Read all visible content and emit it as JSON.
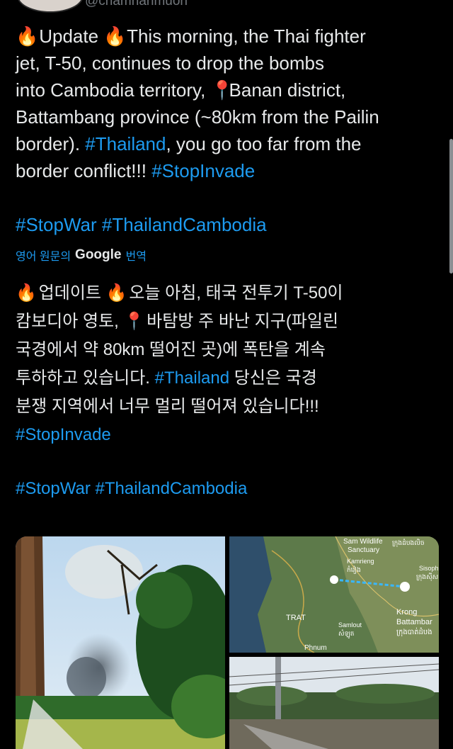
{
  "header": {
    "handle": "@chamnanmuon"
  },
  "post": {
    "lines": [
      {
        "emoji_a": "🔥",
        "t1": "Update",
        "emoji_b": "🔥",
        "t2": "This morning, the Thai fighter"
      },
      {
        "t": "jet, T-50, continues to drop the bombs"
      },
      {
        "t1": "into Cambodia territory,",
        "pin": "📍",
        "t2": "Banan district,"
      },
      {
        "t": "Battambang province (~80km from the Pailin"
      },
      {
        "t1": "border).",
        "tag": "#Thailand",
        "t2": ", you go too far from the"
      },
      {
        "t1": "border conflict!!!",
        "tag": "#StopInvade"
      }
    ],
    "tags_line": [
      "#StopWar",
      "#ThailandCambodia"
    ]
  },
  "translation": {
    "prefix": "영어 원문의",
    "google": "Google",
    "suffix": "번역",
    "lines": [
      {
        "emoji_a": "🔥",
        "t1": "업데이트",
        "emoji_b": "🔥",
        "t2": "오늘 아침, 태국 전투기 T-50이"
      },
      {
        "t1": "캄보디아 영토,",
        "pin": "📍",
        "t2": "바탐방 주 바난 지구(파일린"
      },
      {
        "t": "국경에서 약 80km 떨어진 곳)에 폭탄을 계속"
      },
      {
        "t1": "투하하고 있습니다.",
        "tag": "#Thailand",
        "t2": "당신은 국경"
      },
      {
        "t": "분쟁 지역에서 너무 멀리 떨어져 있습니다!!!"
      },
      {
        "tag": "#StopInvade"
      }
    ],
    "tags_line": [
      "#StopWar",
      "#ThailandCambodia"
    ]
  },
  "map": {
    "labels": {
      "sanctuary_1": "Sam Wildlife",
      "sanctuary_2": "Sanctuary",
      "sanctuary_km": "ក្រុងដំបងលិច",
      "kamrieng": "Kamrieng",
      "kamrieng_km": "កំរៀង",
      "sisoph": "Sisoph",
      "sisoph_km": "ក្រុងស៊ីស",
      "trat": "TRAT",
      "samlout": "Samlout",
      "samlout_km": "សំឡូត",
      "krong": "Krong",
      "battambang": "Battambar",
      "battambang_km": "ក្រុងបាត់ដំបង",
      "phnum": "Phnum"
    }
  }
}
